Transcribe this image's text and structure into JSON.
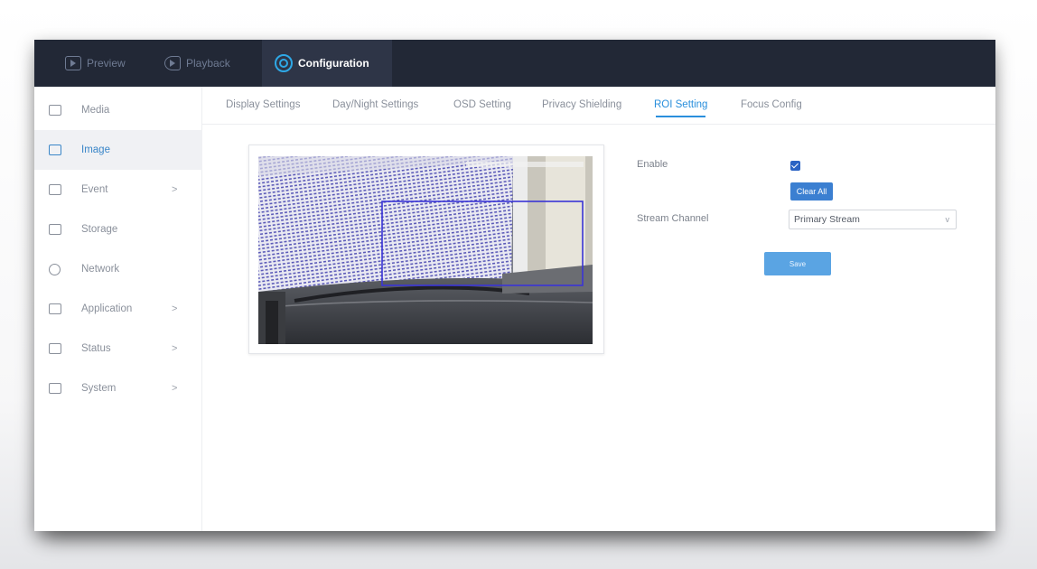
{
  "topnav": {
    "items": [
      {
        "label": "Preview",
        "icon": "preview-icon"
      },
      {
        "label": "Playback",
        "icon": "playback-icon"
      },
      {
        "label": "Configuration",
        "icon": "configuration-icon"
      }
    ],
    "active": "Configuration"
  },
  "sidebar": {
    "items": [
      {
        "label": "Media",
        "icon": "media-icon",
        "has_children": false
      },
      {
        "label": "Image",
        "icon": "image-icon",
        "has_children": false
      },
      {
        "label": "Event",
        "icon": "event-icon",
        "has_children": true,
        "chevron": ">"
      },
      {
        "label": "Storage",
        "icon": "storage-icon",
        "has_children": false
      },
      {
        "label": "Network",
        "icon": "network-icon",
        "has_children": false
      },
      {
        "label": "Application",
        "icon": "application-icon",
        "has_children": true,
        "chevron": ">"
      },
      {
        "label": "Status",
        "icon": "status-icon",
        "has_children": true,
        "chevron": ">"
      },
      {
        "label": "System",
        "icon": "system-icon",
        "has_children": true,
        "chevron": ">"
      }
    ],
    "active": "Image"
  },
  "tabs": {
    "items": [
      "Display Settings",
      "Day/Night Settings",
      "OSD Setting",
      "Privacy Shielding",
      "ROI Setting",
      "Focus Config"
    ],
    "active": "ROI Setting"
  },
  "form": {
    "enable_label": "Enable",
    "enable_checked": true,
    "clear_all_label": "Clear All",
    "stream_channel_label": "Stream Channel",
    "stream_channel_value": "Primary Stream",
    "save_label": "Save"
  },
  "colors": {
    "topbar": "#222836",
    "accent": "#2a8fdc",
    "roi_box": "#3a34d6",
    "button": "#3b7fd1"
  }
}
